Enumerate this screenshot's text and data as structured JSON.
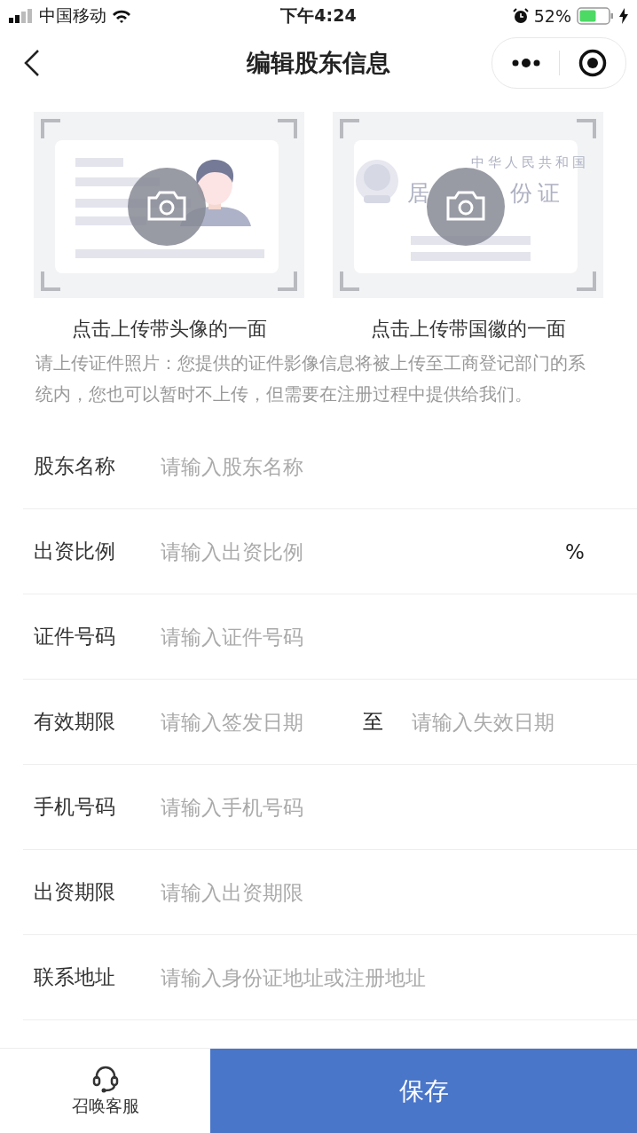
{
  "status_bar": {
    "carrier": "中国移动",
    "time": "下午4:24",
    "battery": "52%"
  },
  "nav": {
    "title": "编辑股东信息"
  },
  "uploads": [
    {
      "kind": "portrait",
      "caption": "点击上传带头像的一面"
    },
    {
      "kind": "emblem",
      "caption": "点击上传带国徽的一面",
      "card_lines": [
        "中华人民共和国",
        "居",
        "份证"
      ]
    }
  ],
  "note": "请上传证件照片：您提供的证件影像信息将被上传至工商登记部门的系统内，您也可以暂时不上传，但需要在注册过程中提供给我们。",
  "fields": [
    {
      "kind": "text",
      "label": "股东名称",
      "placeholder": "请输入股东名称"
    },
    {
      "kind": "percent",
      "label": "出资比例",
      "placeholder": "请输入出资比例",
      "suffix": "%"
    },
    {
      "kind": "text",
      "label": "证件号码",
      "placeholder": "请输入证件号码"
    },
    {
      "kind": "range",
      "label": "有效期限",
      "placeholder": "请输入签发日期",
      "separator": "至",
      "placeholder_end": "请输入失效日期"
    },
    {
      "kind": "text",
      "label": "手机号码",
      "placeholder": "请输入手机号码"
    },
    {
      "kind": "text",
      "label": "出资期限",
      "placeholder": "请输入出资期限"
    },
    {
      "kind": "text",
      "label": "联系地址",
      "placeholder": "请输入身份证地址或注册地址"
    }
  ],
  "bottom_bar": {
    "service": "召唤客服",
    "save": "保存"
  }
}
